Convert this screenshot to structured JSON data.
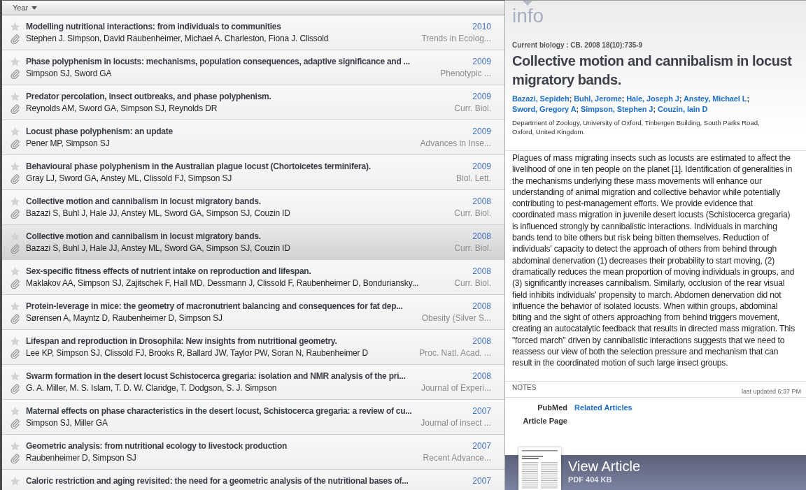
{
  "list": {
    "sort_header": {
      "label": "Year"
    },
    "rows": [
      {
        "title": "Modelling nutritional interactions: from individuals to communities",
        "year": "2010",
        "authors": "Stephen J. Simpson, David Raubenheimer, Michael A. Charleston, Fiona J. Clissold",
        "journal": "Trends in Ecolog...",
        "selected": false,
        "starred": false,
        "attachment": true
      },
      {
        "title": "Phase polyphenism in locusts: mechanisms, population consequences, adaptive significance and ...",
        "year": "2009",
        "authors": "Simpson SJ, Sword GA",
        "journal": "Phenotypic ...",
        "selected": false,
        "starred": false,
        "attachment": true
      },
      {
        "title": "Predator percolation, insect outbreaks, and phase polyphenism.",
        "year": "2009",
        "authors": "Reynolds AM, Sword GA, Simpson SJ, Reynolds DR",
        "journal": "Curr. Biol.",
        "selected": false,
        "starred": false,
        "attachment": true
      },
      {
        "title": "Locust phase polyphenism: an update",
        "year": "2009",
        "authors": "Pener MP, Simpson SJ",
        "journal": "Advances in Inse...",
        "selected": false,
        "starred": false,
        "attachment": true
      },
      {
        "title": "Behavioural phase polyphenism in the Australian plague locust (Chortoicetes terminifera).",
        "year": "2009",
        "authors": "Gray LJ, Sword GA, Anstey ML, Clissold FJ, Simpson SJ",
        "journal": "Biol. Lett.",
        "selected": false,
        "starred": false,
        "attachment": true
      },
      {
        "title": "Collective motion and cannibalism in locust migratory bands.",
        "year": "2008",
        "authors": "Bazazi S, Buhl J, Hale JJ, Anstey ML, Sword GA, Simpson SJ, Couzin ID",
        "journal": "Curr. Biol.",
        "selected": false,
        "starred": false,
        "attachment": true
      },
      {
        "title": "Collective motion and cannibalism in locust migratory bands.",
        "year": "2008",
        "authors": "Bazazi S, Buhl J, Hale JJ, Anstey ML, Sword GA, Simpson SJ, Couzin ID",
        "journal": "Curr. Biol.",
        "selected": true,
        "starred": false,
        "attachment": true
      },
      {
        "title": "Sex-specific fitness effects of nutrient intake on reproduction and lifespan.",
        "year": "2008",
        "authors": "Maklakov AA, Simpson SJ, Zajitschek F, Hall MD, Dessmann J, Clissold F, Raubenheimer D, Bonduriansky...",
        "journal": "Curr. Biol.",
        "selected": false,
        "starred": false,
        "attachment": true
      },
      {
        "title": "Protein-leverage in mice: the geometry of macronutrient balancing and consequences for fat dep...",
        "year": "2008",
        "authors": "Sørensen A, Mayntz D, Raubenheimer D, Simpson SJ",
        "journal": "Obesity (Silver S...",
        "selected": false,
        "starred": false,
        "attachment": true
      },
      {
        "title": "Lifespan and reproduction in Drosophila: New insights from nutritional geometry.",
        "year": "2008",
        "authors": "Lee KP, Simpson SJ, Clissold FJ, Brooks R, Ballard JW, Taylor PW, Soran N, Raubenheimer D",
        "journal": "Proc. Natl. Acad. ...",
        "selected": false,
        "starred": false,
        "attachment": true
      },
      {
        "title": "Swarm formation in the desert locust Schistocerca gregaria: isolation and NMR analysis of the pri...",
        "year": "2008",
        "authors": "G. A. Miller, M. S. Islam, T. D. W. Claridge, T. Dodgson, S. J. Simpson",
        "journal": "Journal of Experi...",
        "selected": false,
        "starred": false,
        "attachment": true
      },
      {
        "title": "Maternal effects on phase characteristics in the desert locust, Schistocerca gregaria: a review of cu...",
        "year": "2007",
        "authors": "Simpson SJ, Miller GA",
        "journal": "Journal of insect ...",
        "selected": false,
        "starred": false,
        "attachment": true
      },
      {
        "title": "Geometric analysis: from nutritional ecology to livestock production",
        "year": "2007",
        "authors": "Raubenheimer D, Simpson SJ",
        "journal": "Recent Advance...",
        "selected": false,
        "starred": false,
        "attachment": true
      },
      {
        "title": "Caloric restriction and aging revisited: the need for a geometric analysis of the nutritional bases of...",
        "year": "2007",
        "selected": false,
        "starred": false
      }
    ]
  },
  "info": {
    "heading": "info",
    "citation": "Current biology : CB. 2008 18(10):735-9",
    "title": "Collective motion and cannibalism in locust migratory bands.",
    "authors": {
      "names": [
        "Bazazi, Sepideh",
        "Buhl, Jerome",
        "Hale, Joseph J",
        "Anstey, Michael L",
        "Sword, Gregory A",
        "Simpson, Stephen J",
        "Couzin, Iain D"
      ],
      "separator": ";"
    },
    "affiliation": "Department of Zoology, University of Oxford, Tinbergen Building, South Parks Road, Oxford, United Kingdom.",
    "abstract": "Plagues of mass migrating insects such as locusts are estimated to affect the livelihood of one in ten people on the planet [1]. Identification of generalities in the mechanisms underlying these mass movements will enhance our understanding of animal migration and collective behavior while potentially contributing to pest-management efforts. We provide evidence that coordinated mass migration in juvenile desert locusts (Schistocerca gregaria) is influenced strongly by cannibalistic interactions. Individuals in marching bands tend to bite others but risk being bitten themselves. Reduction of individuals' capacity to detect the approach of others from behind through abdominal denervation (1) decreases their probability to start moving, (2) dramatically reduces the mean proportion of moving individuals in groups, and (3) significantly increases cannibalism. Similarly, occlusion of the rear visual field inhibits individuals' propensity to march. Abdomen denervation did not influence the behavior of isolated locusts. When within groups, abdominal biting and the sight of others approaching from behind triggers movement, creating an autocatalytic feedback that results in directed mass migration. This \"forced march\" driven by cannibalistic interactions suggests that we need to reassess our view of both the selection pressure and mechanism that can result in the coordinated motion of such large insect groups.",
    "notes": {
      "label": "NOTES",
      "updated": "last updated 6:37 PM"
    },
    "links": [
      {
        "label": "PubMed",
        "value": "Related Articles"
      },
      {
        "label": "Article Page"
      }
    ],
    "view_article": {
      "label": "View Article",
      "detail": "PDF 404 KB"
    }
  }
}
